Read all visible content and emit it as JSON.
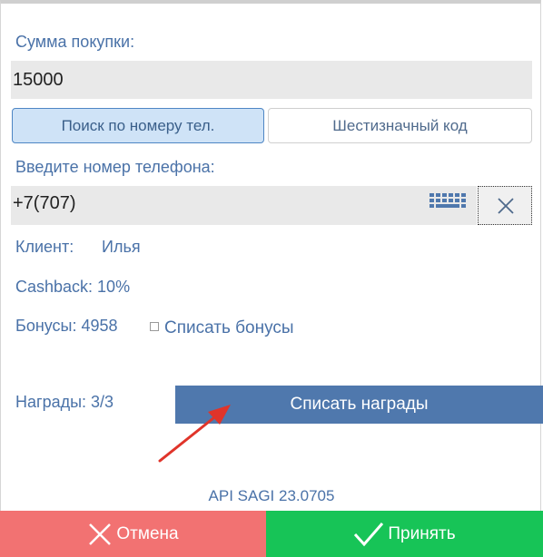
{
  "purchase": {
    "label": "Сумма покупки:",
    "amount": "15000"
  },
  "search_tabs": {
    "phone_tab": "Поиск по номеру тел.",
    "code_tab": "Шестизначный код",
    "active": "phone_tab"
  },
  "phone": {
    "label": "Введите номер телефона:",
    "value": "+7(707)"
  },
  "client": {
    "label": "Клиент:",
    "name": "Илья",
    "cashback": "Cashback: 10%",
    "bonuses": "Бонусы: 4958",
    "redeem_bonuses_label": "Списать бонусы",
    "redeem_bonuses_checked": false,
    "rewards": "Награды: 3/3"
  },
  "actions": {
    "redeem_rewards": "Списать награды",
    "cancel": "Отмена",
    "accept": "Принять"
  },
  "version": "API SAGI 23.0705",
  "colors": {
    "accent_blue": "#4f78ad",
    "label_blue": "#4a72a8",
    "cancel_red": "#f27272",
    "accept_green": "#17c457",
    "annotation_arrow": "#e0342a"
  }
}
